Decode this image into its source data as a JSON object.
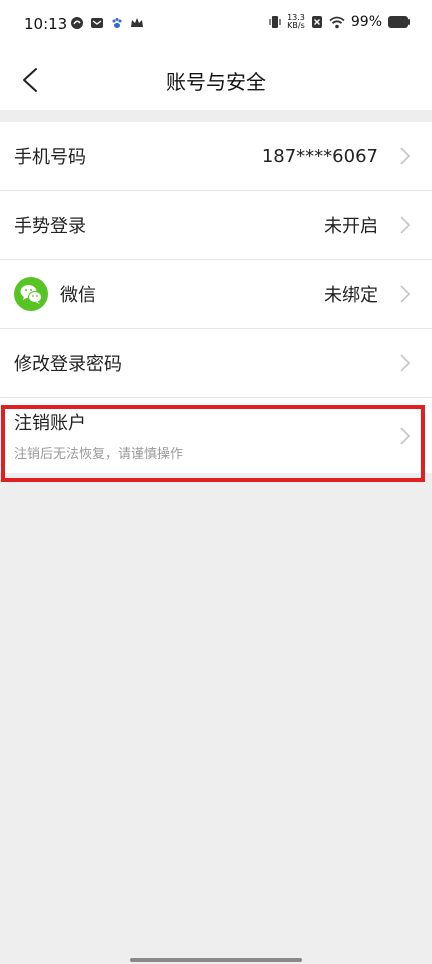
{
  "status_bar": {
    "time": "10:13",
    "net_speed_value": "13.3",
    "net_speed_unit": "KB/s",
    "battery": "99%"
  },
  "header": {
    "title": "账号与安全"
  },
  "rows": [
    {
      "label": "手机号码",
      "value": "187****6067"
    },
    {
      "label": "手势登录",
      "value": "未开启"
    },
    {
      "label": "微信",
      "value": "未绑定"
    },
    {
      "label": "修改登录密码"
    },
    {
      "label": "注销账户",
      "sublabel": "注销后无法恢复，请谨慎操作"
    }
  ],
  "colors": {
    "wechat": "#58c324",
    "highlight": "#e02020",
    "background": "#eeeeee"
  }
}
